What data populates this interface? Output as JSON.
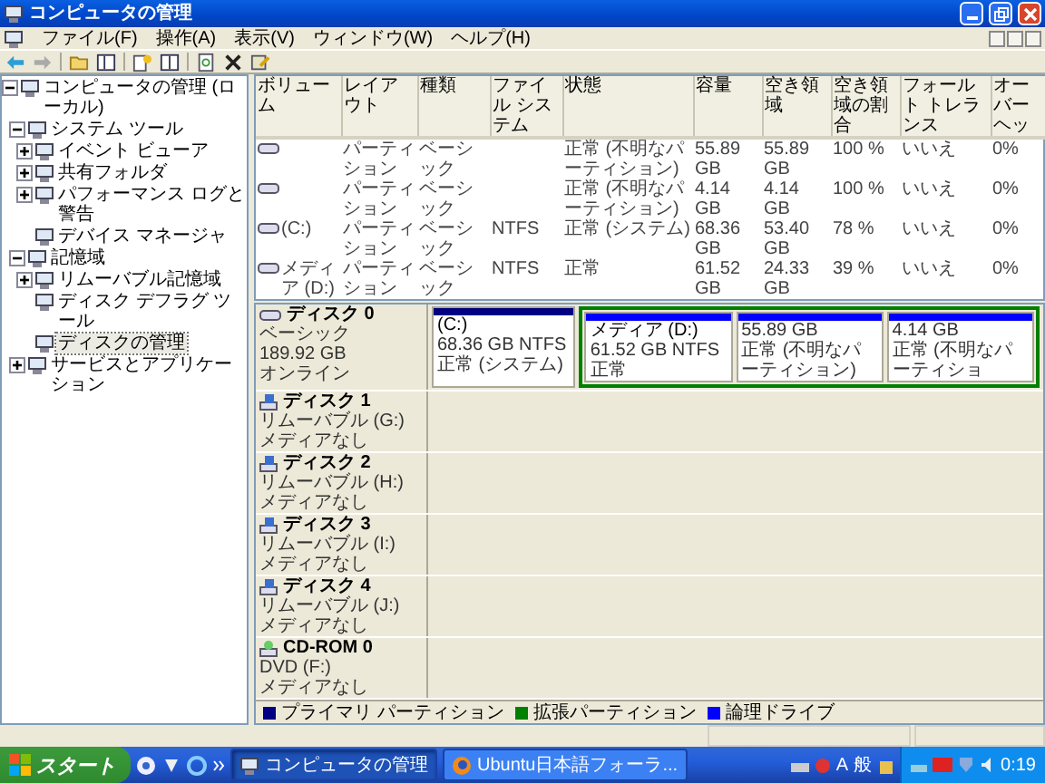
{
  "window": {
    "title": "コンピュータの管理"
  },
  "menu": [
    "ファイル(F)",
    "操作(A)",
    "表示(V)",
    "ウィンドウ(W)",
    "ヘルプ(H)"
  ],
  "tree": [
    {
      "label": "コンピュータの管理 (ローカル)",
      "kind": "node",
      "expanded": true,
      "selected": false,
      "children": [
        {
          "label": "システム ツール",
          "kind": "node",
          "expanded": true,
          "selected": false,
          "children": [
            {
              "label": "イベント ビューア",
              "kind": "node",
              "expanded": false,
              "selected": false
            },
            {
              "label": "共有フォルダ",
              "kind": "node",
              "expanded": false,
              "selected": false
            },
            {
              "label": "パフォーマンス ログと警告",
              "kind": "node",
              "expanded": false,
              "selected": false
            },
            {
              "label": "デバイス マネージャ",
              "kind": "leaf",
              "selected": false
            }
          ]
        },
        {
          "label": "記憶域",
          "kind": "node",
          "expanded": true,
          "selected": false,
          "children": [
            {
              "label": "リムーバブル記憶域",
              "kind": "node",
              "expanded": false,
              "selected": false
            },
            {
              "label": "ディスク デフラグ ツール",
              "kind": "leaf",
              "selected": false
            },
            {
              "label": "ディスクの管理",
              "kind": "leaf",
              "selected": true
            }
          ]
        },
        {
          "label": "サービスとアプリケーション",
          "kind": "node",
          "expanded": false,
          "selected": false
        }
      ]
    }
  ],
  "volumes": {
    "columns": [
      "ボリューム",
      "レイアウト",
      "種類",
      "ファイル システム",
      "状態",
      "容量",
      "空き領域",
      "空き領域の割合",
      "フォールト トレランス",
      "オーバーヘッ"
    ],
    "rows": [
      {
        "layout": "パーティション",
        "type": "ベーシック",
        "status": "正常 (不明なパーティション)",
        "capacity": "55.89 GB",
        "free": "55.89 GB",
        "free_pct": "100 %",
        "fault_tolerance": "いいえ",
        "overhead": "0%"
      },
      {
        "layout": "パーティション",
        "type": "ベーシック",
        "status": "正常 (不明なパーティション)",
        "capacity": "4.14 GB",
        "free": "4.14 GB",
        "free_pct": "100 %",
        "fault_tolerance": "いいえ",
        "overhead": "0%"
      },
      {
        "volume": "(C:)",
        "layout": "パーティション",
        "type": "ベーシック",
        "file_system": "NTFS",
        "status": "正常 (システム)",
        "capacity": "68.36 GB",
        "free": "53.40 GB",
        "free_pct": "78 %",
        "fault_tolerance": "いいえ",
        "overhead": "0%"
      },
      {
        "volume": "メディア (D:)",
        "layout": "パーティション",
        "type": "ベーシック",
        "file_system": "NTFS",
        "status": "正常",
        "capacity": "61.52 GB",
        "free": "24.33 GB",
        "free_pct": "39 %",
        "fault_tolerance": "いいえ",
        "overhead": "0%"
      }
    ]
  },
  "disks": [
    {
      "kind": "fixed",
      "name": "ディスク 0",
      "type": "ベーシック",
      "size": "189.92 GB",
      "status": "オンライン",
      "partitions": [
        {
          "kind": "primary",
          "label": "(C:)",
          "size": "68.36 GB NTFS",
          "status": "正常 (システム)"
        },
        {
          "kind": "extended",
          "children": [
            {
              "kind": "logical",
              "label": "メディア (D:)",
              "size": "61.52 GB NTFS",
              "status": "正常"
            },
            {
              "kind": "logical",
              "size": "55.89 GB",
              "status": "正常 (不明なパーティション)"
            },
            {
              "kind": "logical",
              "size": "4.14 GB",
              "status": "正常 (不明なパーティショ"
            }
          ]
        }
      ]
    },
    {
      "kind": "removable",
      "name": "ディスク 1",
      "type": "リムーバブル (G:)",
      "status": "メディアなし"
    },
    {
      "kind": "removable",
      "name": "ディスク 2",
      "type": "リムーバブル (H:)",
      "status": "メディアなし"
    },
    {
      "kind": "removable",
      "name": "ディスク 3",
      "type": "リムーバブル (I:)",
      "status": "メディアなし"
    },
    {
      "kind": "removable",
      "name": "ディスク 4",
      "type": "リムーバブル (J:)",
      "status": "メディアなし"
    },
    {
      "kind": "cdrom",
      "name": "CD-ROM 0",
      "type": "DVD (F:)",
      "status": "メディアなし"
    }
  ],
  "legend": [
    {
      "label": "プライマリ パーティション",
      "color": "#000080"
    },
    {
      "label": "拡張パーティション",
      "color": "#008000"
    },
    {
      "label": "論理ドライブ",
      "color": "#0000ff"
    }
  ],
  "taskbar": {
    "start": "スタート",
    "tasks": [
      {
        "label": "コンピュータの管理",
        "selected": true
      },
      {
        "label": "Ubuntu日本語フォーラ...",
        "selected": false
      }
    ],
    "language": [
      "A",
      "般"
    ],
    "clock": "0:19"
  }
}
